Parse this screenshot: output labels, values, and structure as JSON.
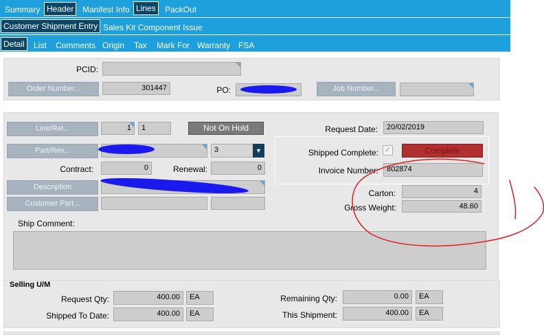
{
  "tabs_top": [
    "Summary",
    "Header",
    "Manifest Info",
    "Lines",
    "PackOut"
  ],
  "tabs_second": [
    "Customer Shipment Entry",
    "Sales Kit Component Issue"
  ],
  "tabs_third": [
    "Detail",
    "List",
    "Comments",
    "Origin",
    "Tax",
    "Mark For",
    "Warranty",
    "FSA"
  ],
  "header": {
    "pcid_label": "PCID:",
    "order_number_button": "Order Number...",
    "order_number_value": "301447",
    "po_label": "PO:",
    "job_number_button": "Job Number..."
  },
  "line": {
    "line_rel_button": "Line/Rel...",
    "line_value": "1",
    "rel_value": "1",
    "hold_status": "Not On Hold",
    "part_rev_button": "Part/Rev...",
    "rev_value": "3",
    "contract_label": "Contract:",
    "contract_value": "0",
    "renewal_label": "Renewal:",
    "renewal_value": "0",
    "description_button": "Description",
    "customer_part_button": "Customer Part...",
    "request_date_label": "Request Date:",
    "request_date_value": "20/02/2019",
    "shipped_complete_label": "Shipped Complete:",
    "complete_button": "Complete",
    "invoice_number_label": "Invoice Number:",
    "invoice_number_value": "802874",
    "carton_label": "Carton:",
    "carton_value": "4",
    "gross_weight_label": "Gross Weight:",
    "gross_weight_value": "48.60",
    "ship_comment_label": "Ship Comment:"
  },
  "selling": {
    "title": "Selling U/M",
    "request_qty_label": "Request Qty:",
    "request_qty_value": "400.00",
    "request_qty_um": "EA",
    "shipped_to_date_label": "Shipped To Date:",
    "shipped_to_date_value": "400.00",
    "shipped_to_date_um": "EA",
    "remaining_qty_label": "Remaining Qty:",
    "remaining_qty_value": "0.00",
    "remaining_qty_um": "EA",
    "this_shipment_label": "This Shipment:",
    "this_shipment_value": "400.00",
    "this_shipment_um": "EA"
  },
  "colors": {
    "tab_bar": "#1ea0dc",
    "selected_tab": "#0c4566",
    "complete_button": "#b03030",
    "annotation_red": "#e02020",
    "redaction_blue": "#1a1aee"
  }
}
